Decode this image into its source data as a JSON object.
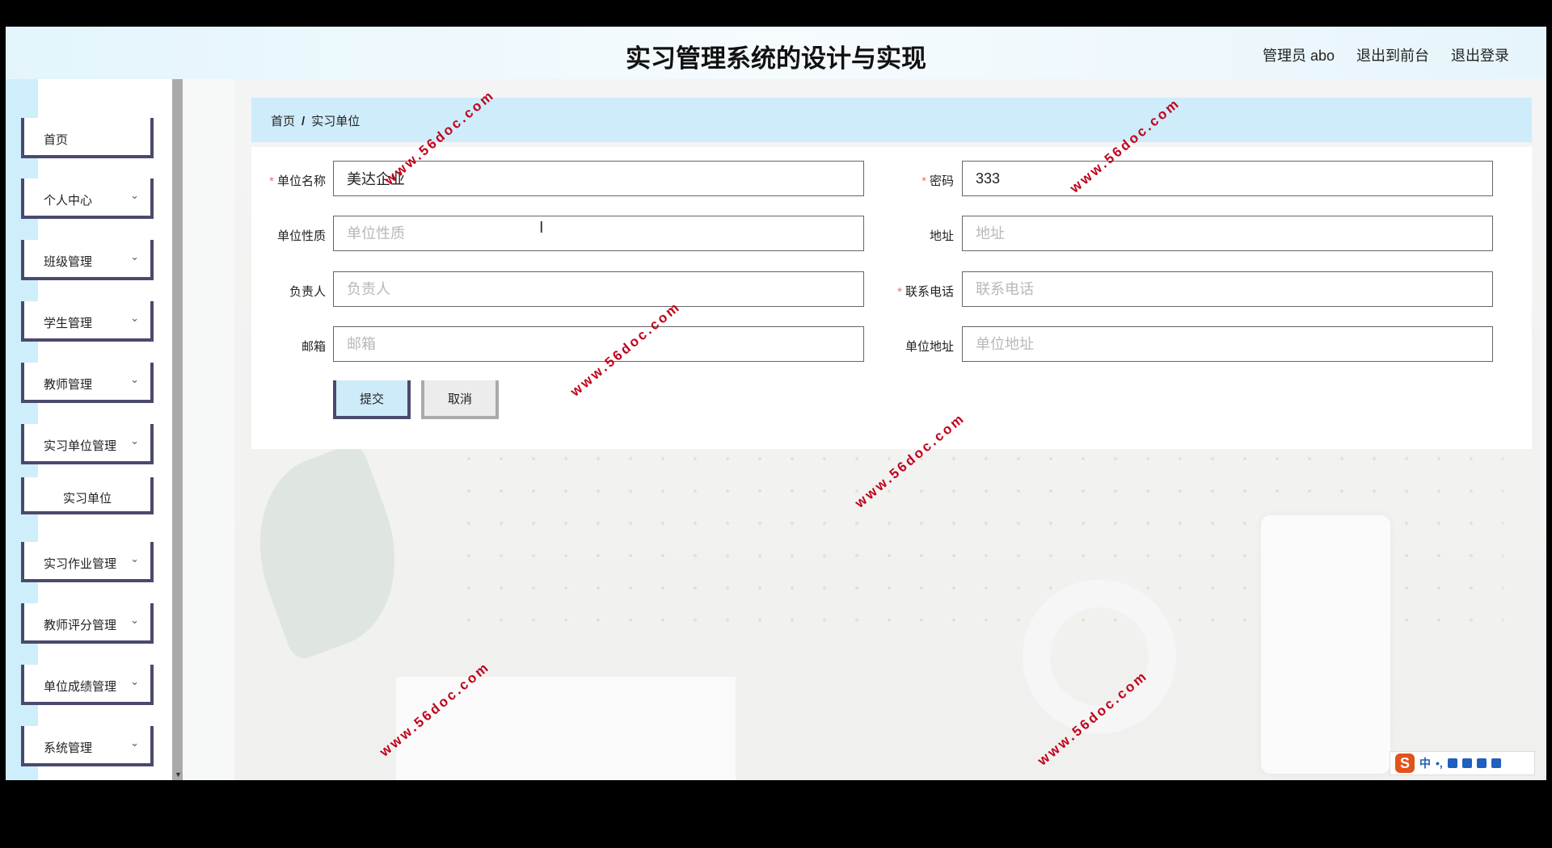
{
  "header": {
    "title": "实习管理系统的设计与实现",
    "user_label": "管理员 abo",
    "front_link": "退出到前台",
    "logout_link": "退出登录"
  },
  "sidebar": {
    "items": [
      {
        "label": "首页",
        "has_submenu": false
      },
      {
        "label": "个人中心",
        "has_submenu": true
      },
      {
        "label": "班级管理",
        "has_submenu": true
      },
      {
        "label": "学生管理",
        "has_submenu": true
      },
      {
        "label": "教师管理",
        "has_submenu": true
      },
      {
        "label": "实习单位管理",
        "has_submenu": true
      },
      {
        "label": "实习单位",
        "has_submenu": false
      },
      {
        "label": "实习作业管理",
        "has_submenu": true
      },
      {
        "label": "教师评分管理",
        "has_submenu": true
      },
      {
        "label": "单位成绩管理",
        "has_submenu": true
      },
      {
        "label": "系统管理",
        "has_submenu": true
      }
    ],
    "chevron": "⌄"
  },
  "breadcrumb": {
    "home": "首页",
    "separator": "/",
    "current": "实习单位"
  },
  "form": {
    "unit_name": {
      "label": "单位名称",
      "required": true,
      "value": "美达企业",
      "placeholder": "单位名称"
    },
    "password": {
      "label": "密码",
      "required": true,
      "value": "333",
      "placeholder": "密码"
    },
    "unit_nature": {
      "label": "单位性质",
      "required": false,
      "value": "",
      "placeholder": "单位性质"
    },
    "address": {
      "label": "地址",
      "required": false,
      "value": "",
      "placeholder": "地址"
    },
    "contact_person": {
      "label": "负责人",
      "required": false,
      "value": "",
      "placeholder": "负责人"
    },
    "phone": {
      "label": "联系电话",
      "required": true,
      "value": "",
      "placeholder": "联系电话"
    },
    "email": {
      "label": "邮箱",
      "required": false,
      "value": "",
      "placeholder": "邮箱"
    },
    "unit_address": {
      "label": "单位地址",
      "required": false,
      "value": "",
      "placeholder": "单位地址"
    },
    "submit_label": "提交",
    "cancel_label": "取消",
    "required_mark": "*"
  },
  "watermark": {
    "text": "www.56doc.com"
  },
  "ime": {
    "logo": "S",
    "mode": "中",
    "punct": "•,"
  },
  "colors": {
    "accent_border": "#4a4a6e",
    "breadcrumb_bg": "#cfecfb",
    "required": "#f56c6c",
    "watermark": "#c0001a"
  }
}
